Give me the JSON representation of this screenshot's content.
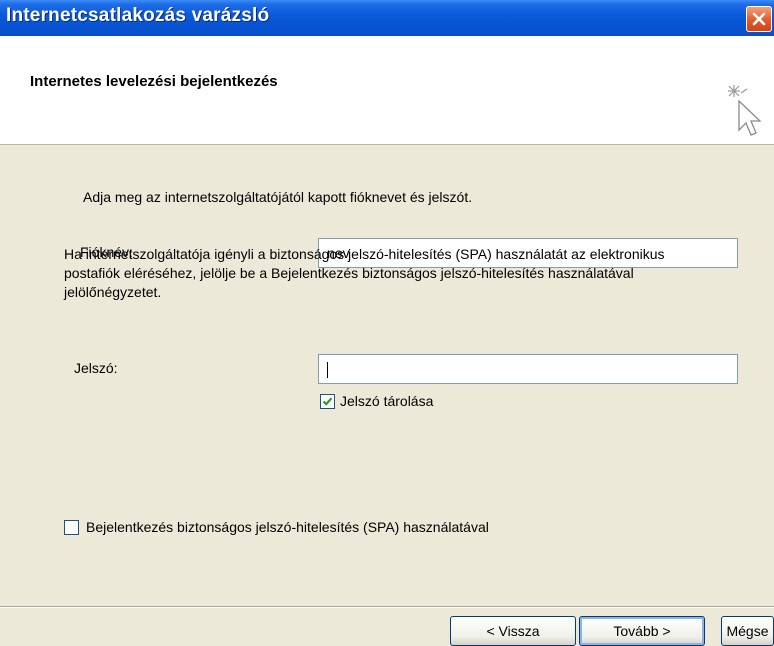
{
  "window": {
    "title": "Internetcsatlakozás varázsló"
  },
  "header": {
    "title": "Internetes levelezési bejelentkezés"
  },
  "form": {
    "intro": "Adja meg az internetszolgáltatójától kapott fióknevet és jelszót.",
    "account_label": "Fióknév:",
    "account_value": "nev",
    "password_label": "Jelszó:",
    "password_value": "",
    "remember_label": "Jelszó tárolása",
    "remember_checked": true,
    "spa_paragraph": "Ha internetszolgáltatója igényli a biztonságos jelszó-hitelesítés (SPA) használatát az elektronikus postafiók eléréséhez, jelölje be a Bejelentkezés biztonságos jelszó-hitelesítés használatával jelölőnégyzetet.",
    "spa_label": "Bejelentkezés biztonságos jelszó-hitelesítés (SPA) használatával",
    "spa_checked": false
  },
  "buttons": {
    "back": "< Vissza",
    "next": "Tovább >",
    "cancel": "Mégse"
  },
  "icons": {
    "close": "close-icon",
    "wizard": "wizard-cursor-icon",
    "check": "checkmark-icon"
  },
  "colors": {
    "titlebar": "#0A5BDB",
    "dialog_bg": "#ECE9D8",
    "close": "#E2582E",
    "checkmark": "#21A121"
  }
}
